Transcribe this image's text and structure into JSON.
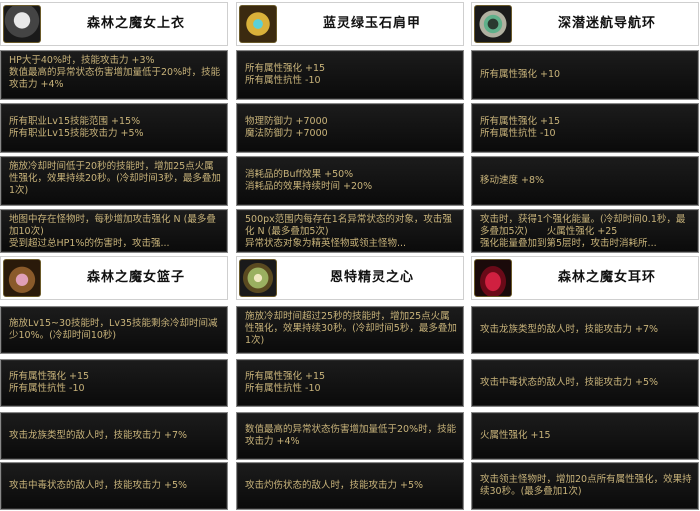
{
  "items": [
    {
      "name": "森林之魔女上衣",
      "icon": "robe-icon",
      "stats": [
        "HP大于40%时，技能攻击力 +3%\n数值最高的异常状态伤害增加量低于20%时，技能攻击力 +4%",
        "所有职业Lv15技能范围 +15%\n所有职业Lv15技能攻击力 +5%",
        "施放冷却时间低于20秒的技能时，增加25点火属性强化，效果持续20秒。(冷却时间3秒，最多叠加1次)",
        "地图中存在怪物时，每秒增加攻击强化 N (最多叠加10次)\n受到超过总HP1%的伤害时，攻击强..."
      ]
    },
    {
      "name": "蓝灵绿玉石肩甲",
      "icon": "shoulder-armor-icon",
      "stats": [
        "所有属性强化 +15\n所有属性抗性 -10",
        "物理防御力 +7000\n魔法防御力 +7000",
        "消耗品的Buff效果 +50%\n消耗品的效果持续时间 +20%",
        "500px范围内每存在1名异常状态的对象，攻击强化 N (最多叠加5次)\n异常状态对象为精英怪物或领主怪物..."
      ]
    },
    {
      "name": "深潜迷航导航环",
      "icon": "navigation-ring-icon",
      "stats": [
        "所有属性强化 +10",
        "所有属性强化 +15\n所有属性抗性 -10",
        "移动速度 +8%",
        "攻击时，获得1个强化能量。(冷却时间0.1秒，最多叠加5次)　　火属性强化 +25\n强化能量叠加到第5层时，攻击时消耗所..."
      ]
    },
    {
      "name": "森林之魔女篮子",
      "icon": "basket-icon",
      "stats": [
        "施放Lv15~30技能时，Lv35技能剩余冷却时间减少10%。(冷却时间10秒)",
        "所有属性强化 +15\n所有属性抗性 -10",
        "攻击龙族类型的敌人时，技能攻击力 +7%",
        "攻击中毒状态的敌人时，技能攻击力 +5%"
      ]
    },
    {
      "name": "恩特精灵之心",
      "icon": "spirit-heart-icon",
      "stats": [
        "施放冷却时间超过25秒的技能时，增加25点火属性强化，效果持续30秒。(冷却时间5秒，最多叠加1次)",
        "所有属性强化 +15\n所有属性抗性 -10",
        "数值最高的异常状态伤害增加量低于20%时，技能攻击力 +4%",
        "攻击灼伤状态的敌人时，技能攻击力 +5%"
      ]
    },
    {
      "name": "森林之魔女耳环",
      "icon": "earring-icon",
      "stats": [
        "攻击龙族类型的敌人时，技能攻击力 +7%",
        "攻击中毒状态的敌人时，技能攻击力 +5%",
        "火属性强化 +15",
        "攻击领主怪物时，增加20点所有属性强化，效果持续30秒。(最多叠加1次)"
      ]
    }
  ]
}
